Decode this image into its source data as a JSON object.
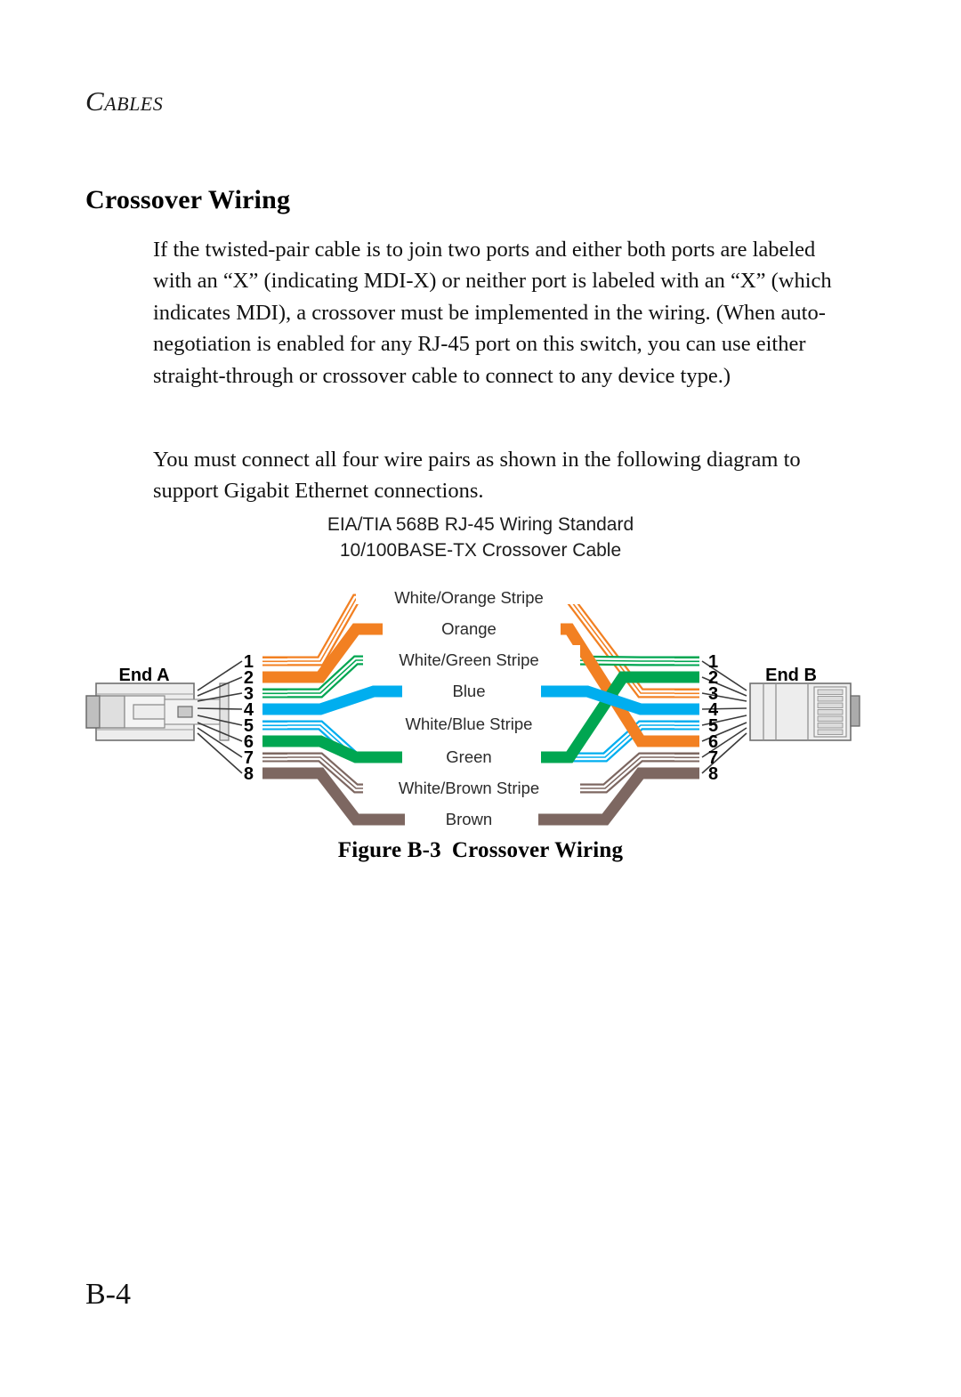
{
  "page": {
    "running_head": "CABLES",
    "running_head_first": "C",
    "running_head_rest": "ABLES",
    "page_number": "B-4"
  },
  "section": {
    "heading": "Crossover Wiring",
    "paragraphs": [
      "If the twisted-pair cable is to join two ports and either both ports are labeled with an “X” (indicating MDI-X) or neither port is labeled with an “X” (which indicates MDI), a crossover must be implemented in the wiring. (When auto-negotiation is enabled for any RJ-45 port on this switch, you can use either straight-through or crossover cable to connect to any device type.)",
      "You must connect all four wire pairs as shown in the following diagram to support Gigabit Ethernet connections."
    ]
  },
  "figure": {
    "title_line1": "EIA/TIA 568B RJ-45 Wiring Standard",
    "title_line2": "10/100BASE-TX Crossover Cable",
    "caption_number": "Figure B-3",
    "caption_text": "Crossover Wiring",
    "end_a_label": "End A",
    "end_b_label": "End B",
    "pin_numbers": [
      "1",
      "2",
      "3",
      "4",
      "5",
      "6",
      "7",
      "8"
    ],
    "wire_labels": [
      "White/Orange Stripe",
      "Orange",
      "White/Green Stripe",
      "Blue",
      "White/Blue Stripe",
      "Green",
      "White/Brown Stripe",
      "Brown"
    ],
    "colors": {
      "orange": "#F28022",
      "green": "#00A651",
      "blue": "#00AEEF",
      "brown": "#7D6761",
      "white": "#FFFFFF",
      "connector_body": "#E8E8E8",
      "connector_edge": "#6E6E6E",
      "leader_line": "#3A3A3A"
    },
    "end_a_pinout": [
      {
        "pin": "1",
        "wire": "White/Orange Stripe",
        "color": "#F28022",
        "striped": true
      },
      {
        "pin": "2",
        "wire": "Orange",
        "color": "#F28022",
        "striped": false
      },
      {
        "pin": "3",
        "wire": "White/Green Stripe",
        "color": "#00A651",
        "striped": true
      },
      {
        "pin": "4",
        "wire": "Blue",
        "color": "#00AEEF",
        "striped": false
      },
      {
        "pin": "5",
        "wire": "White/Blue Stripe",
        "color": "#00AEEF",
        "striped": true
      },
      {
        "pin": "6",
        "wire": "Green",
        "color": "#00A651",
        "striped": false
      },
      {
        "pin": "7",
        "wire": "White/Brown Stripe",
        "color": "#7D6761",
        "striped": true
      },
      {
        "pin": "8",
        "wire": "Brown",
        "color": "#7D6761",
        "striped": false
      }
    ],
    "end_b_pinout": [
      {
        "pin": "1",
        "wire": "White/Green Stripe",
        "color": "#00A651",
        "striped": true
      },
      {
        "pin": "2",
        "wire": "Green",
        "color": "#00A651",
        "striped": false
      },
      {
        "pin": "3",
        "wire": "White/Orange Stripe",
        "color": "#F28022",
        "striped": true
      },
      {
        "pin": "4",
        "wire": "Blue",
        "color": "#00AEEF",
        "striped": false
      },
      {
        "pin": "5",
        "wire": "White/Blue Stripe",
        "color": "#00AEEF",
        "striped": true
      },
      {
        "pin": "6",
        "wire": "Orange",
        "color": "#F28022",
        "striped": false
      },
      {
        "pin": "7",
        "wire": "White/Brown Stripe",
        "color": "#7D6761",
        "striped": true
      },
      {
        "pin": "8",
        "wire": "Brown",
        "color": "#7D6761",
        "striped": false
      }
    ]
  }
}
